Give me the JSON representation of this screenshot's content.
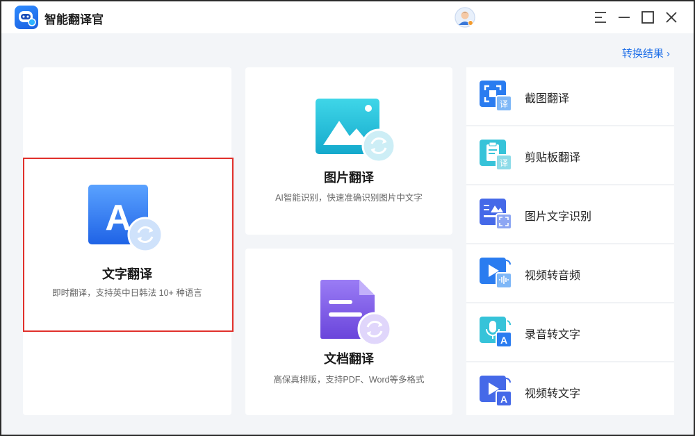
{
  "app": {
    "title": "智能翻译官"
  },
  "header": {
    "result_link": "转换结果 ›"
  },
  "cards": {
    "text": {
      "title": "文字翻译",
      "desc": "即时翻译，支持英中日韩法 10+ 种语言"
    },
    "image": {
      "title": "图片翻译",
      "desc": "AI智能识别，快速准确识别图片中文字"
    },
    "document": {
      "title": "文档翻译",
      "desc": "高保真排版，支持PDF、Word等多格式"
    }
  },
  "tools": [
    {
      "label": "截图翻译",
      "icon": "screenshot-translate-icon"
    },
    {
      "label": "剪贴板翻译",
      "icon": "clipboard-translate-icon"
    },
    {
      "label": "图片文字识别",
      "icon": "image-ocr-icon"
    },
    {
      "label": "视频转音频",
      "icon": "video-to-audio-icon"
    },
    {
      "label": "录音转文字",
      "icon": "recording-to-text-icon"
    },
    {
      "label": "视频转文字",
      "icon": "video-to-text-icon"
    }
  ],
  "colors": {
    "accent": "#1f6fe8",
    "selection": "#e0302b"
  }
}
